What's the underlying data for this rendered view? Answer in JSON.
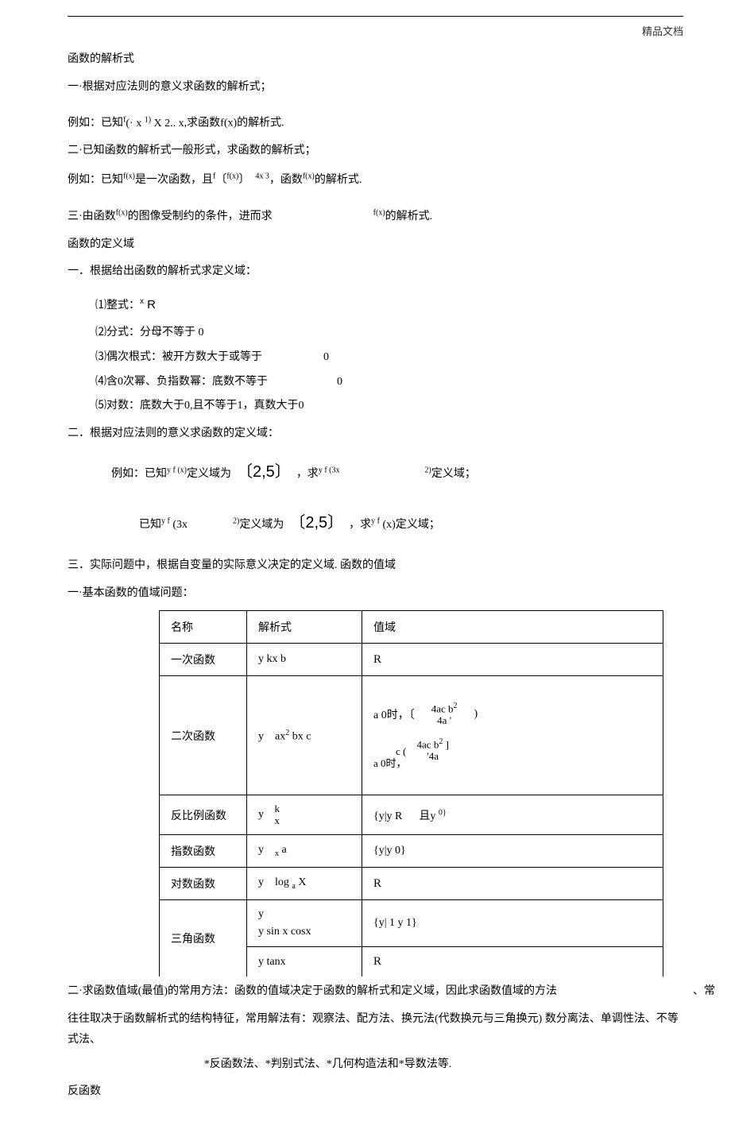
{
  "header": {
    "label": "精品文档"
  },
  "sec1": {
    "title": "函数的解析式",
    "p1": "一·根据对应法则的意义求函数的解析式；",
    "ex1_pre": "例如：已知",
    "ex1_expr": "f(·x 1) X 2.. x",
    "ex1_post": ",求函数f(x)的解析式.",
    "p2": "二·已知函数的解析式一般形式，求函数的解析式；",
    "ex2_pre": "例如：已知f(x)是一次函数，且",
    "ex2_expr": "f〔f(x)〕  4x 3",
    "ex2_post": "，函数f(x)的解析式.",
    "p3_pre": "三·由函数f(x)的图像受制约的条件，进而求",
    "p3_post": "f(x)的解析式."
  },
  "sec2": {
    "title": "函数的定义域",
    "p1": "一．根据给出函数的解析式求定义域：",
    "i1_pre": "⑴整式：",
    "i1_expr": "x R",
    "i2": "⑵分式：分母不等于 0",
    "i3_pre": "⑶偶次根式：被开方数大于或等于",
    "i3_val": "0",
    "i4_pre": "⑷含0次幂、负指数幂：底数不等于",
    "i4_val": "0",
    "i5": "⑸对数：底数大于0,且不等于1，真数大于0",
    "p2": "二．根据对应法则的意义求函数的定义域：",
    "ex3a": "例如：已知y f(x)定义域为",
    "ex3b": "〔2,5〕",
    "ex3c": "，求y f(3x",
    "ex3d": "2)定义域；",
    "ex4a": "已知y f (3x",
    "ex4b": "2)定义域为",
    "ex4c": "〔2,5〕",
    "ex4d": "，求y f (x)定义域；",
    "p3": "三．实际问题中，根据自变量的实际意义决定的定义域. 函数的值域",
    "p4": "一·基本函数的值域问题："
  },
  "table": {
    "h1": "名称",
    "h2": "解析式",
    "h3": "值域",
    "r1": {
      "name": "一次函数",
      "expr": "y    kx b",
      "range": "R"
    },
    "r2": {
      "name": "二次函数",
      "expr": "y    ax2 bx c",
      "line1a": "a 0时，〔",
      "frac1_num": "4ac b2",
      "frac1_den": "4a '",
      "line1b": ")",
      "line2a": "a 0时，",
      "line2b": "c        (",
      "frac2_num": "4ac b2 ]",
      "frac2_den": "'4a"
    },
    "r3": {
      "name": "反比例函数",
      "expr_y": "y",
      "expr_num": "k",
      "expr_den": "x",
      "range": "{y|y R      且y 0}"
    },
    "r4": {
      "name": "指数函数",
      "expr": "y     x a",
      "range": "{y|y 0}"
    },
    "r5": {
      "name": "对数函数",
      "expr": "y    log a X",
      "range": "R"
    },
    "r6": {
      "name": "三角函数",
      "e1": "y",
      "e2": "y    sin x cosx",
      "e3": "y    tanx",
      "range1": "{y| 1 y      1}",
      "range2": "R"
    }
  },
  "sec3": {
    "p1_a": "二·求函数值域(最值)的常用方法：函数的值域决定于函数的解析式和定义域，因此求函数值域的方法",
    "p1_b": "、常",
    "p2": "往往取决于函数解析式的结构特征，常用解法有：观察法、配方法、换元法(代数换元与三角换元) 数分离法、单调性法、不等式法、",
    "p3": "*反函数法、*判别式法、*几何构造法和*导数法等.",
    "p4": "反函数"
  }
}
